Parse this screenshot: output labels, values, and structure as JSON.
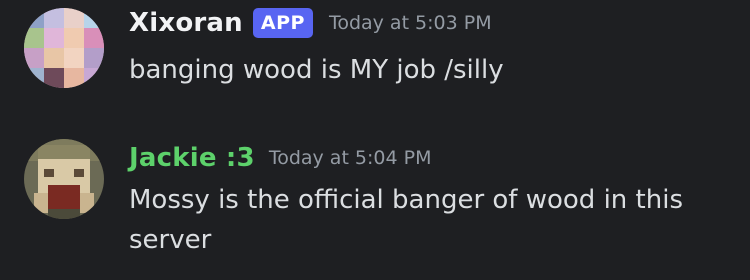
{
  "messages": [
    {
      "author": "Xixoran",
      "badge": "APP",
      "timestamp": "Today at 5:03 PM",
      "content": "banging wood is MY job /silly",
      "name_color": "#f2f3f5"
    },
    {
      "author": "Jackie :3",
      "timestamp": "Today at 5:04 PM",
      "content": "Mossy is the official banger of wood in this server",
      "name_color": "#5dd16b"
    }
  ],
  "theme": {
    "background": "#1e1f22",
    "badge_color": "#5865f2",
    "timestamp_color": "#949ba4",
    "text_color": "#dbdee1"
  }
}
